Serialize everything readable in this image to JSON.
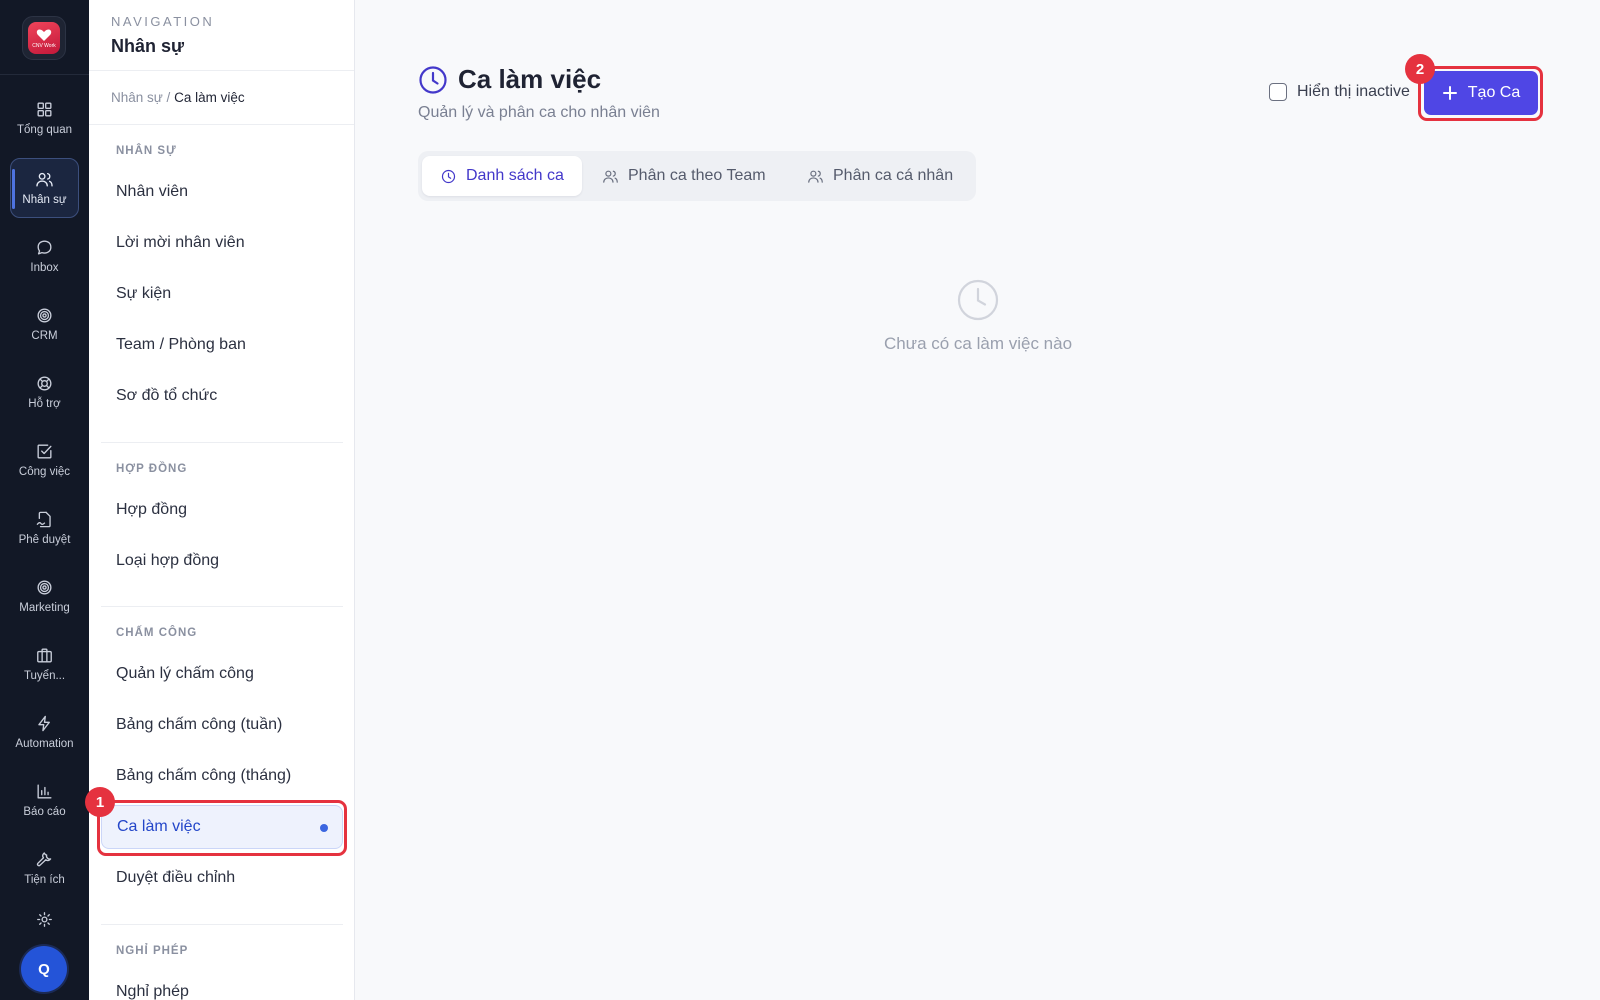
{
  "app": {
    "logo_text": "CNV Work",
    "avatar_initial": "Q"
  },
  "rail": {
    "items": [
      {
        "label": "Tổng quan",
        "icon": "grid-icon"
      },
      {
        "label": "Nhân sự",
        "icon": "users-icon",
        "active": true
      },
      {
        "label": "Inbox",
        "icon": "chat-icon"
      },
      {
        "label": "CRM",
        "icon": "target-icon"
      },
      {
        "label": "Hỗ trợ",
        "icon": "lifebuoy-icon"
      },
      {
        "label": "Công việc",
        "icon": "check-square-icon"
      },
      {
        "label": "Phê duyệt",
        "icon": "file-signature-icon"
      },
      {
        "label": "Marketing",
        "icon": "target-icon"
      },
      {
        "label": "Tuyển...",
        "icon": "briefcase-icon"
      },
      {
        "label": "Automation",
        "icon": "lightning-icon"
      },
      {
        "label": "Báo cáo",
        "icon": "bar-chart-icon"
      },
      {
        "label": "Tiện ích",
        "icon": "wrench-icon"
      },
      {
        "label": "",
        "icon": "gear-icon"
      }
    ]
  },
  "nav": {
    "caption": "NAVIGATION",
    "title": "Nhân sự",
    "breadcrumb": {
      "parent": "Nhân sự /",
      "current": "Ca làm việc"
    },
    "sections": [
      {
        "label": "NHÂN SỰ",
        "items": [
          "Nhân viên",
          "Lời mời nhân viên",
          "Sự kiện",
          "Team / Phòng ban",
          "Sơ đồ tổ chức"
        ]
      },
      {
        "label": "HỢP ĐỒNG",
        "items": [
          "Hợp đồng",
          "Loại hợp đồng"
        ]
      },
      {
        "label": "CHẤM CÔNG",
        "items": [
          "Quản lý chấm công",
          "Bảng chấm công (tuần)",
          "Bảng chấm công (tháng)",
          "Ca làm việc",
          "Duyệt điều chỉnh"
        ]
      },
      {
        "label": "NGHỈ PHÉP",
        "items": [
          "Nghỉ phép"
        ]
      }
    ],
    "active_item": "Ca làm việc"
  },
  "main": {
    "title": "Ca làm việc",
    "subtitle": "Quản lý và phân ca cho nhân viên",
    "inactive_label": "Hiển thị inactive",
    "inactive_checked": false,
    "create_button": "Tạo Ca",
    "tabs": [
      {
        "label": "Danh sách ca",
        "icon": "clock-icon",
        "active": true
      },
      {
        "label": "Phân ca theo Team",
        "icon": "users-icon"
      },
      {
        "label": "Phân ca cá nhân",
        "icon": "users-icon"
      }
    ],
    "empty_text": "Chưa có ca làm việc nào"
  },
  "annotations": {
    "badge_1": "1",
    "badge_2": "2"
  },
  "colors": {
    "rail_bg": "#121826",
    "accent": "#4f46e5",
    "highlight": "#e5323f",
    "active_nav_bg": "#eef2fd"
  }
}
